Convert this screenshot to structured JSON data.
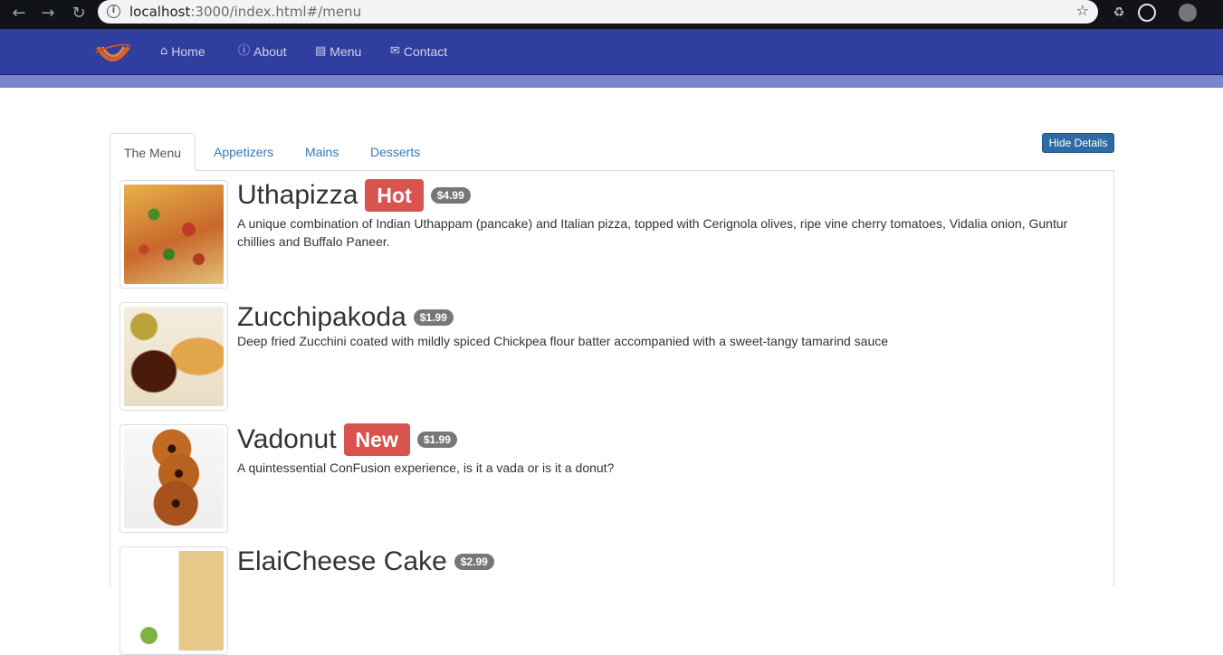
{
  "browser": {
    "url_host": "localhost",
    "url_path": ":3000/index.html#/menu"
  },
  "navbar": {
    "items": [
      {
        "label": "Home",
        "icon": "home-icon"
      },
      {
        "label": "About",
        "icon": "info-icon"
      },
      {
        "label": "Menu",
        "icon": "list-icon"
      },
      {
        "label": "Contact",
        "icon": "envelope-icon"
      }
    ]
  },
  "tabs": [
    {
      "label": "The Menu",
      "active": true
    },
    {
      "label": "Appetizers",
      "active": false
    },
    {
      "label": "Mains",
      "active": false
    },
    {
      "label": "Desserts",
      "active": false
    }
  ],
  "hide_details_label": "Hide Details",
  "dishes": [
    {
      "name": "Uthapizza",
      "label": "Hot",
      "price": "$4.99",
      "description": "A unique combination of Indian Uthappam (pancake) and Italian pizza, topped with Cerignola olives, ripe vine cherry tomatoes, Vidalia onion, Guntur chillies and Buffalo Paneer."
    },
    {
      "name": "Zucchipakoda",
      "label": "",
      "price": "$1.99",
      "description": "Deep fried Zucchini coated with mildly spiced Chickpea flour batter accompanied with a sweet-tangy tamarind sauce"
    },
    {
      "name": "Vadonut",
      "label": "New",
      "price": "$1.99",
      "description": "A quintessential ConFusion experience, is it a vada or is it a donut?"
    },
    {
      "name": "ElaiCheese Cake",
      "label": "",
      "price": "$2.99",
      "description": ""
    }
  ]
}
